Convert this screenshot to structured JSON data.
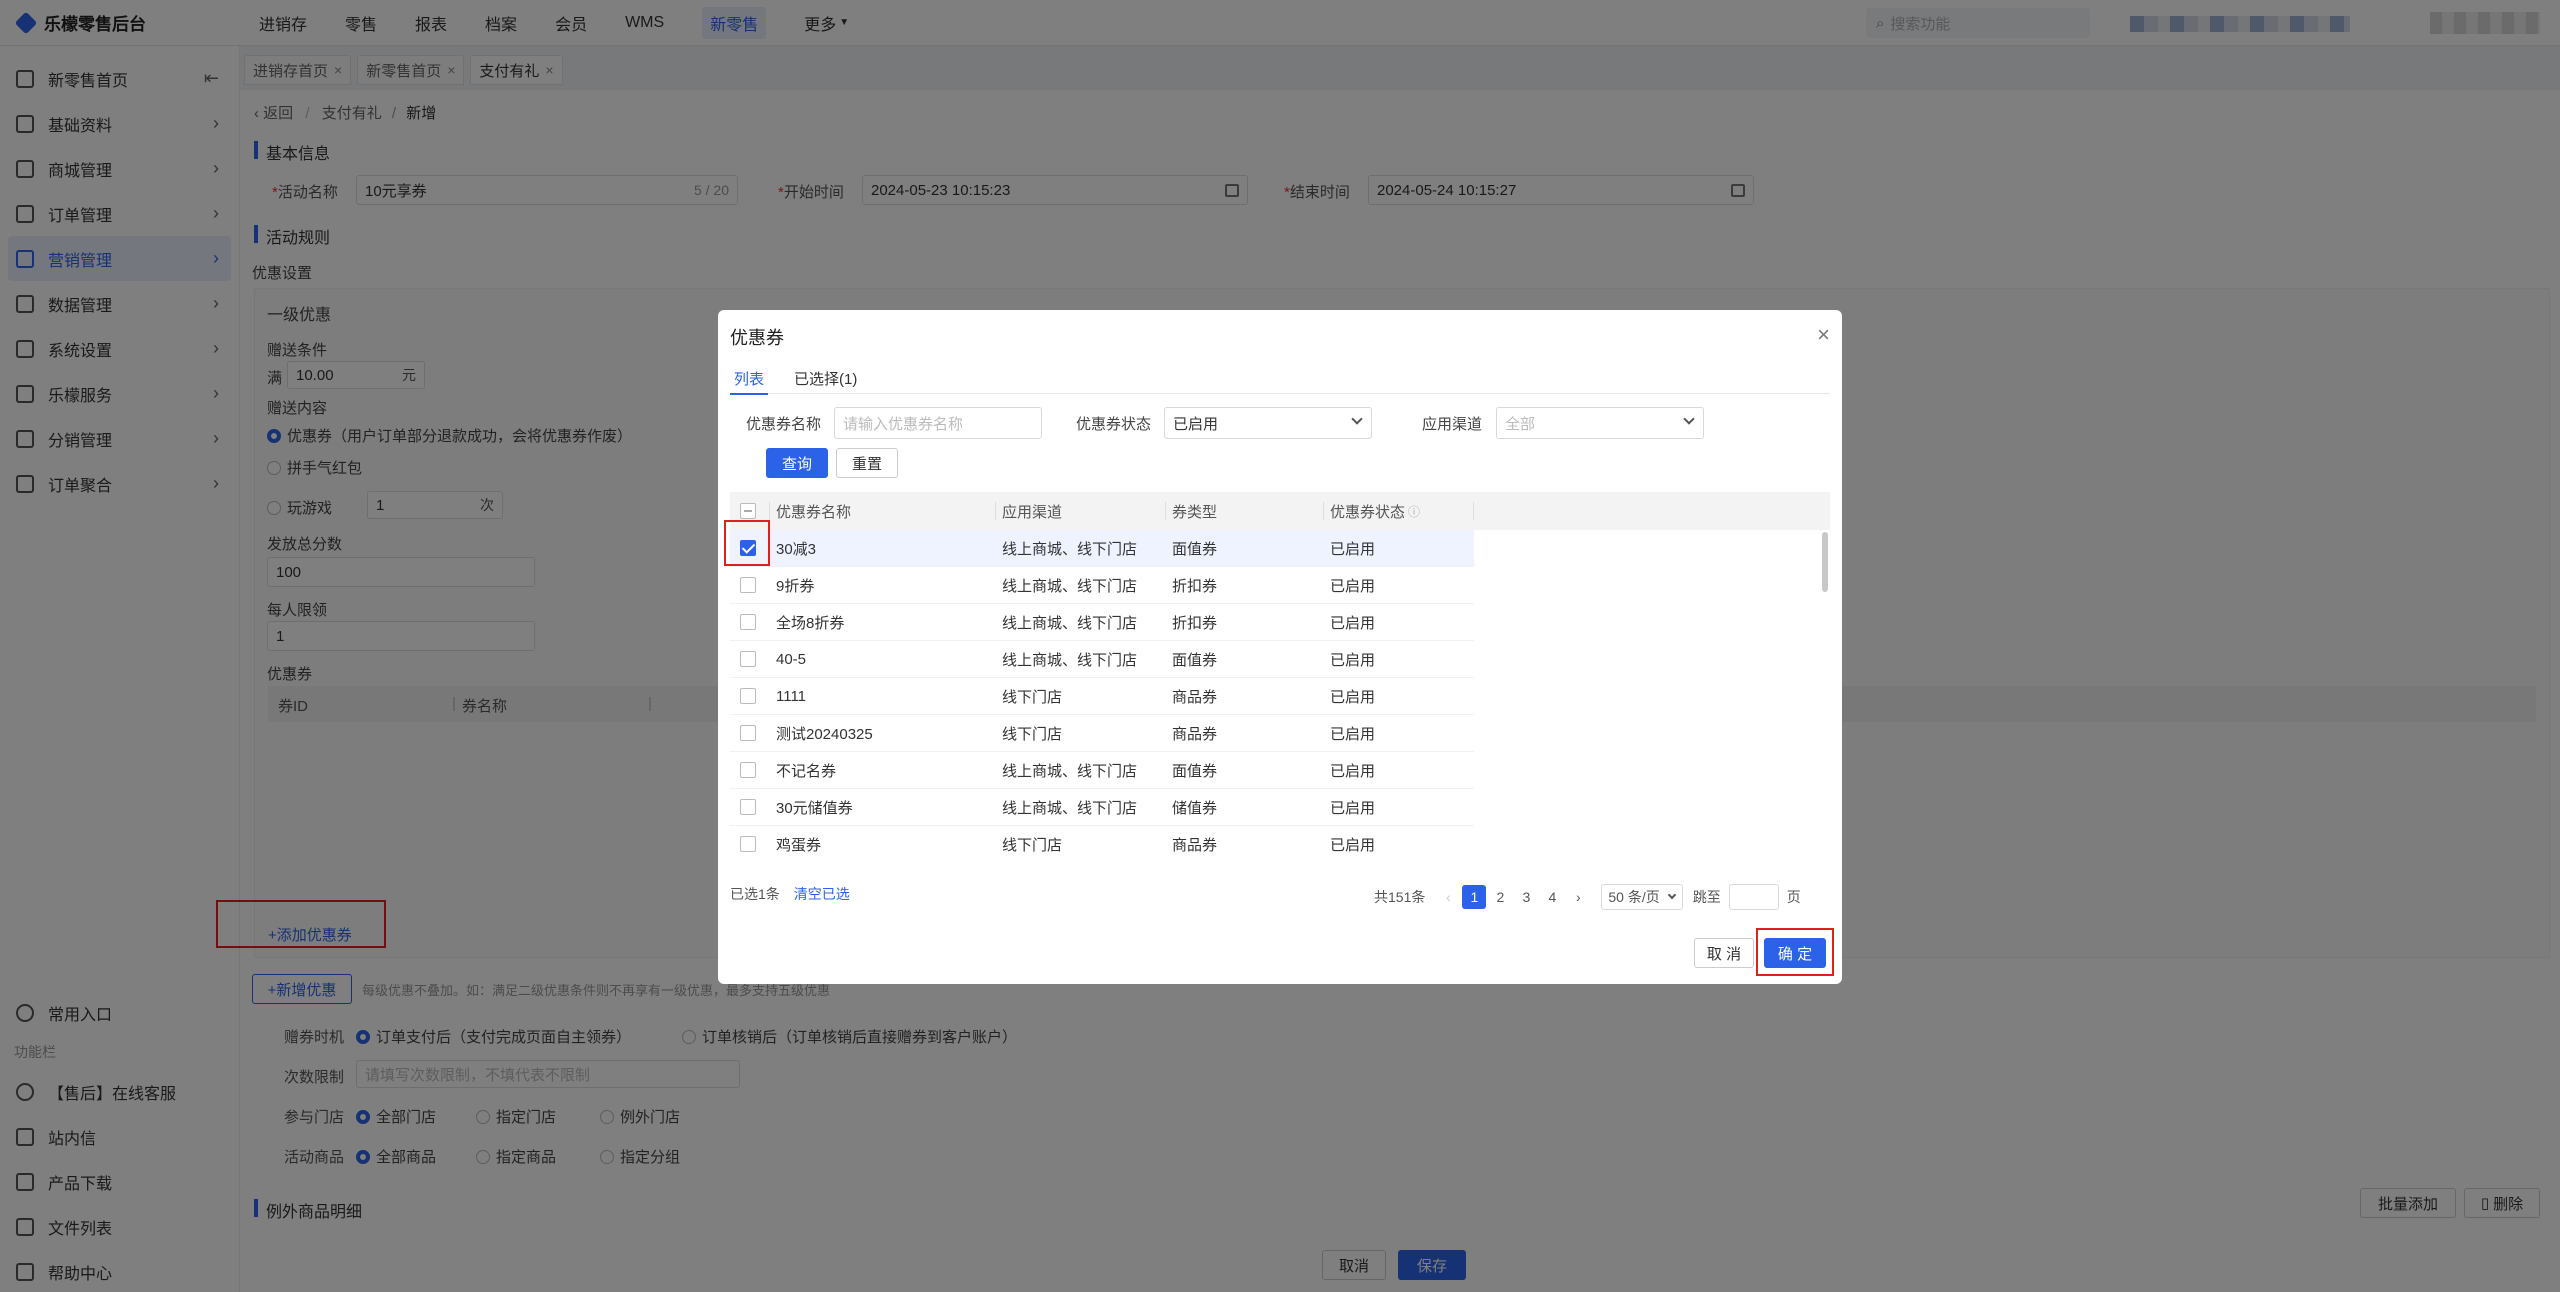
{
  "app": {
    "title": "乐檬零售后台"
  },
  "topnav": [
    "进销存",
    "零售",
    "报表",
    "档案",
    "会员",
    "WMS",
    "新零售",
    "更多"
  ],
  "search": {
    "placeholder": "搜索功能"
  },
  "sidebar": {
    "items": [
      {
        "label": "新零售首页",
        "icon": "home-icon"
      },
      {
        "label": "基础资料",
        "icon": "grid-icon"
      },
      {
        "label": "商城管理",
        "icon": "shop-icon"
      },
      {
        "label": "订单管理",
        "icon": "order-icon"
      },
      {
        "label": "营销管理",
        "icon": "marketing-icon"
      },
      {
        "label": "数据管理",
        "icon": "chart-icon"
      },
      {
        "label": "系统设置",
        "icon": "gear-icon"
      },
      {
        "label": "乐檬服务",
        "icon": "service-icon"
      },
      {
        "label": "分销管理",
        "icon": "distribution-icon"
      },
      {
        "label": "订单聚合",
        "icon": "aggregate-icon"
      }
    ],
    "common_entry": "常用入口",
    "function_bar": "功能栏",
    "bottom": [
      "【售后】在线客服",
      "站内信",
      "产品下载",
      "文件列表",
      "帮助中心"
    ]
  },
  "page_tabs": [
    "进销存首页",
    "新零售首页",
    "支付有礼"
  ],
  "breadcrumb": {
    "back": "返回",
    "parent": "支付有礼",
    "current": "新增"
  },
  "form": {
    "basic_info": "基本信息",
    "activity_name_label": "活动名称",
    "activity_name_value": "10元享券",
    "activity_name_count": "5 / 20",
    "start_label": "开始时间",
    "start_value": "2024-05-23 10:15:23",
    "end_label": "结束时间",
    "end_value": "2024-05-24 10:15:27",
    "rules": "活动规则",
    "discount_settings": "优惠设置",
    "level1": "一级优惠",
    "gift_condition": "赠送条件",
    "full": "满",
    "full_value": "10.00",
    "yuan": "元",
    "gift_content": "赠送内容",
    "opt_coupon": "优惠券（用户订单部分退款成功，会将优惠券作废）",
    "opt_redpack": "拼手气红包",
    "opt_game": "玩游戏",
    "game_value": "1",
    "times": "次",
    "total_label": "发放总分数",
    "total_value": "100",
    "limit_label": "每人限领",
    "limit_value": "1",
    "coupon_label": "优惠券",
    "col_id": "券ID",
    "col_name": "券名称",
    "add_coupon": "+添加优惠券",
    "add_level": "+新增优惠",
    "level_note": "每级优惠不叠加。如：满足二级优惠条件则不再享有一级优惠，最多支持五级优惠",
    "gift_time_label": "赠券时机",
    "gift_time_opt1": "订单支付后（支付完成页面自主领券）",
    "gift_time_opt2": "订单核销后（订单核销后直接赠券到客户账户）",
    "times_limit_label": "次数限制",
    "times_limit_placeholder": "请填写次数限制，不填代表不限制",
    "store_label": "参与门店",
    "store_opts": [
      "全部门店",
      "指定门店",
      "例外门店"
    ],
    "goods_label": "活动商品",
    "goods_opts": [
      "全部商品",
      "指定商品",
      "指定分组"
    ],
    "exception_goods": "例外商品明细",
    "batch_add": "批量添加",
    "delete": "删除",
    "cancel": "取消",
    "save": "保存"
  },
  "modal": {
    "title": "优惠券",
    "tabs": [
      "列表",
      "已选择(1)"
    ],
    "name_label": "优惠券名称",
    "name_placeholder": "请输入优惠券名称",
    "status_label": "优惠券状态",
    "status_value": "已启用",
    "channel_label": "应用渠道",
    "channel_value": "全部",
    "query": "查询",
    "reset": "重置",
    "columns": [
      "优惠券名称",
      "应用渠道",
      "券类型",
      "优惠券状态"
    ],
    "rows": [
      {
        "name": "30减3",
        "channel": "线上商城、线下门店",
        "type": "面值券",
        "status": "已启用",
        "checked": true
      },
      {
        "name": "9折券",
        "channel": "线上商城、线下门店",
        "type": "折扣券",
        "status": "已启用",
        "checked": false
      },
      {
        "name": "全场8折券",
        "channel": "线上商城、线下门店",
        "type": "折扣券",
        "status": "已启用",
        "checked": false
      },
      {
        "name": "40-5",
        "channel": "线上商城、线下门店",
        "type": "面值券",
        "status": "已启用",
        "checked": false
      },
      {
        "name": "1111",
        "channel": "线下门店",
        "type": "商品券",
        "status": "已启用",
        "checked": false
      },
      {
        "name": "测试20240325",
        "channel": "线下门店",
        "type": "商品券",
        "status": "已启用",
        "checked": false
      },
      {
        "name": "不记名券",
        "channel": "线上商城、线下门店",
        "type": "面值券",
        "status": "已启用",
        "checked": false
      },
      {
        "name": "30元储值券",
        "channel": "线上商城、线下门店",
        "type": "储值券",
        "status": "已启用",
        "checked": false
      },
      {
        "name": "鸡蛋券",
        "channel": "线下门店",
        "type": "商品券",
        "status": "已启用",
        "checked": false
      }
    ],
    "selected_count": "已选1条",
    "clear_selected": "清空已选",
    "total": "共151条",
    "pages": [
      "1",
      "2",
      "3",
      "4"
    ],
    "page_size": "50 条/页",
    "jump_to": "跳至",
    "page_unit": "页",
    "cancel": "取 消",
    "confirm": "确 定"
  }
}
